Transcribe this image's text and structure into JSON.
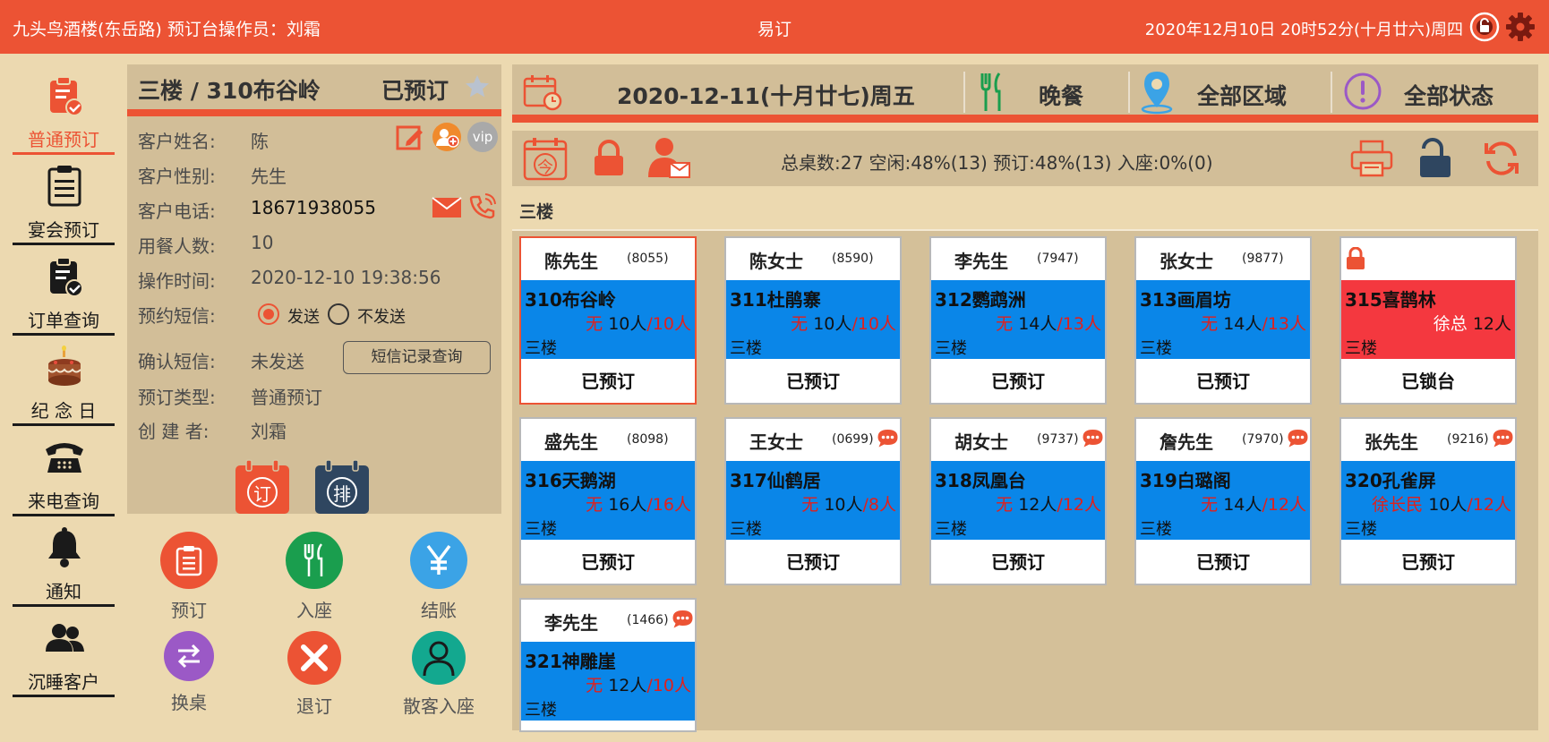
{
  "topbar": {
    "left": "九头鸟酒楼(东岳路)  预订台操作员：刘霜",
    "center": "易订",
    "right": "2020年12月10日 20时52分(十月廿六)周四"
  },
  "nav": {
    "items": [
      {
        "label": "普通预订",
        "icon": "clipboard-check-icon"
      },
      {
        "label": "宴会预订",
        "icon": "clipboard-icon"
      },
      {
        "label": "订单查询",
        "icon": "clipboard-search-icon"
      },
      {
        "label": "纪 念 日",
        "icon": "cake-icon"
      },
      {
        "label": "来电查询",
        "icon": "telephone-icon"
      },
      {
        "label": "通知",
        "icon": "bell-icon"
      },
      {
        "label": "沉睡客户",
        "icon": "users-icon"
      }
    ]
  },
  "detail": {
    "title": "三楼 / 310布谷岭",
    "status": "已预订",
    "fields": {
      "name_label": "客户姓名:",
      "name": "陈",
      "gender_label": "客户性别:",
      "gender": "先生",
      "phone_label": "客户电话:",
      "phone": "18671938055",
      "people_label": "用餐人数:",
      "people": "10",
      "time_label": "操作时间:",
      "time": "2020-12-10 19:38:56",
      "sms_label": "预约短信:",
      "sms_send": "发送",
      "sms_nosend": "不发送",
      "confirm_label": "确认短信:",
      "confirm": "未发送",
      "type_label": "预订类型:",
      "type": "普通预订",
      "creator_label": "创 建 者:",
      "creator": "刘霜"
    },
    "sms_button": "短信记录查询",
    "vip": "vip",
    "cal_ding": "订",
    "cal_pai": "排"
  },
  "actions": [
    {
      "label": "预订",
      "icon": "clipboard-icon",
      "color": "#ec5334"
    },
    {
      "label": "入座",
      "icon": "fork-knife-icon",
      "color": "#1a9e4e"
    },
    {
      "label": "结账",
      "icon": "yen-icon",
      "color": "#3ba3e6"
    },
    {
      "label": "换桌",
      "icon": "swap-icon",
      "color": "#9b59c6"
    },
    {
      "label": "退订",
      "icon": "close-icon",
      "color": "#ec5334"
    },
    {
      "label": "散客入座",
      "icon": "person-icon",
      "color": "#13a88f"
    }
  ],
  "mainhead": {
    "date": "2020-12-11(十月廿七)周五",
    "meal": "晚餐",
    "area": "全部区域",
    "state": "全部状态"
  },
  "toolbar": {
    "today": "今",
    "stats": "总桌数:27  空闲:48%(13)  预订:48%(13)  入座:0%(0)"
  },
  "floor": "三楼",
  "tables": [
    {
      "name": "陈先生",
      "phone": "(8055)",
      "room": "310布谷岭",
      "guest": "无",
      "people": "10人",
      "cap": "/10人",
      "floor": "三楼",
      "status": "已预订",
      "msg": false,
      "selected": true
    },
    {
      "name": "陈女士",
      "phone": "(8590)",
      "room": "311杜鹃寨",
      "guest": "无",
      "people": "10人",
      "cap": "/10人",
      "floor": "三楼",
      "status": "已预订",
      "msg": false
    },
    {
      "name": "李先生",
      "phone": "(7947)",
      "room": "312鹦鹉洲",
      "guest": "无",
      "people": "14人",
      "cap": "/13人",
      "floor": "三楼",
      "status": "已预订",
      "msg": false
    },
    {
      "name": "张女士",
      "phone": "(9877)",
      "room": "313画眉坊",
      "guest": "无",
      "people": "14人",
      "cap": "/13人",
      "floor": "三楼",
      "status": "已预订",
      "msg": false
    },
    {
      "name": "",
      "phone": "",
      "room": "315喜鹊林",
      "guest": "徐总",
      "people": "12人",
      "cap": "",
      "floor": "三楼",
      "status": "已锁台",
      "msg": false,
      "locked": true
    },
    {
      "name": "盛先生",
      "phone": "(8098)",
      "room": "316天鹅湖",
      "guest": "无",
      "people": "16人",
      "cap": "/16人",
      "floor": "三楼",
      "status": "已预订",
      "msg": false
    },
    {
      "name": "王女士",
      "phone": "(0699)",
      "room": "317仙鹤居",
      "guest": "无",
      "people": "10人",
      "cap": "/8人",
      "floor": "三楼",
      "status": "已预订",
      "msg": true
    },
    {
      "name": "胡女士",
      "phone": "(9737)",
      "room": "318凤凰台",
      "guest": "无",
      "people": "12人",
      "cap": "/12人",
      "floor": "三楼",
      "status": "已预订",
      "msg": true
    },
    {
      "name": "詹先生",
      "phone": "(7970)",
      "room": "319白璐阁",
      "guest": "无",
      "people": "14人",
      "cap": "/12人",
      "floor": "三楼",
      "status": "已预订",
      "msg": true
    },
    {
      "name": "张先生",
      "phone": "(9216)",
      "room": "320孔雀屏",
      "guest": "徐长民",
      "people": "10人",
      "cap": "/12人",
      "floor": "三楼",
      "status": "已预订",
      "msg": true
    },
    {
      "name": "李先生",
      "phone": "(1466)",
      "room": "321神雕崖",
      "guest": "无",
      "people": "12人",
      "cap": "/10人",
      "floor": "三楼",
      "status": "",
      "msg": true
    }
  ],
  "colors": {
    "brand": "#ec5334",
    "table_reserved": "#0a86e8",
    "table_locked": "#f4383f"
  }
}
